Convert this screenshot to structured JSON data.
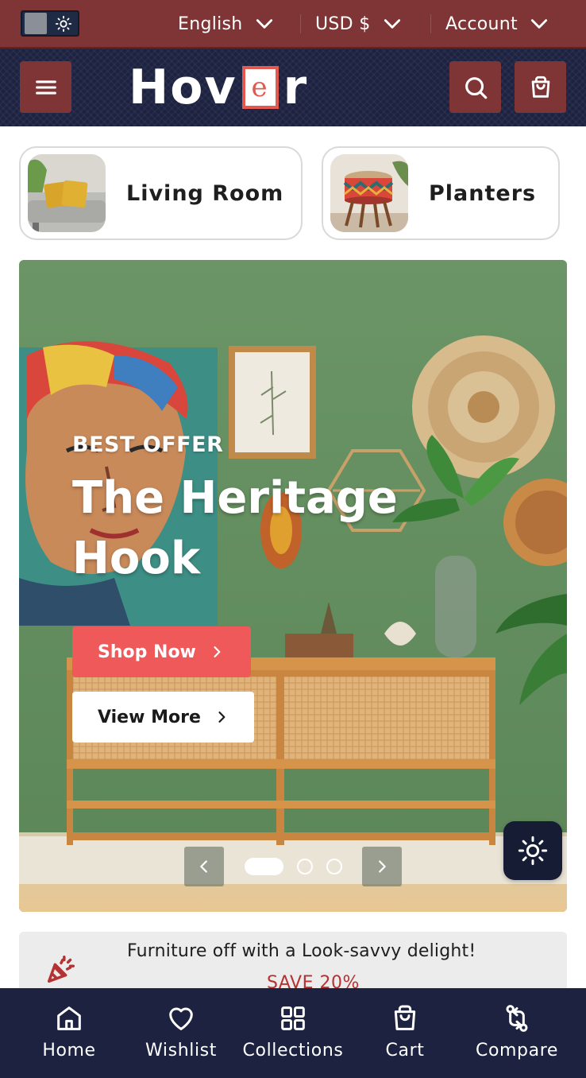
{
  "topbar": {
    "theme_toggle_icon": "sun-icon",
    "language": "English",
    "currency": "USD $",
    "account": "Account"
  },
  "header": {
    "logo": {
      "part1": "Ho",
      "part2": "v",
      "boxed_letter": "e",
      "part3": "r"
    },
    "icons": [
      "menu-icon",
      "search-icon",
      "bag-icon"
    ]
  },
  "categories": [
    {
      "label": "Living Room"
    },
    {
      "label": "Planters"
    }
  ],
  "hero": {
    "kicker": "BEST OFFER",
    "title": "The Heritage Hook",
    "shop_button": "Shop Now",
    "view_button": "View More",
    "slide_count": 3,
    "active_slide": 1
  },
  "promo": {
    "text": "Furniture off with a Look-savvy delight!",
    "save": "SAVE 20%"
  },
  "bottom_nav": [
    {
      "label": "Home",
      "icon": "home-icon"
    },
    {
      "label": "Wishlist",
      "icon": "heart-icon"
    },
    {
      "label": "Collections",
      "icon": "grid-icon"
    },
    {
      "label": "Cart",
      "icon": "bag-icon"
    },
    {
      "label": "Compare",
      "icon": "compare-icon"
    }
  ],
  "colors": {
    "brand_maroon": "#7f3535",
    "navy": "#1c2240",
    "accent_coral": "#f0595a"
  }
}
